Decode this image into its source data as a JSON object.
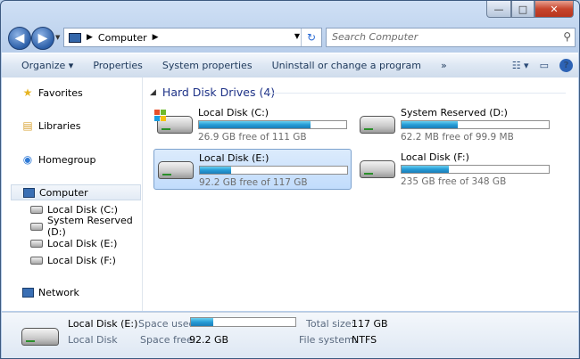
{
  "window": {
    "minimize": "—",
    "maximize": "□",
    "close": "✕"
  },
  "nav_buttons": {
    "back": "◀",
    "forward": "▶",
    "dropdown": "▼"
  },
  "address": {
    "path": [
      "Computer"
    ],
    "sep": "▶",
    "refresh": "↻"
  },
  "search": {
    "placeholder": "Search Computer",
    "icon": "⚲"
  },
  "toolbar": {
    "items": [
      "Organize ▾",
      "Properties",
      "System properties",
      "Uninstall or change a program",
      "»"
    ],
    "view_icon": "☷ ▾",
    "pane_icon": "▭",
    "help": "?"
  },
  "sidebar": {
    "favorites": "Favorites",
    "libraries": "Libraries",
    "homegroup": "Homegroup",
    "computer": "Computer",
    "drives": [
      "Local Disk (C:)",
      "System Reserved (D:)",
      "Local Disk (E:)",
      "Local Disk (F:)"
    ],
    "network": "Network"
  },
  "group": {
    "title": "Hard Disk Drives (4)"
  },
  "drives": [
    {
      "name": "Local Disk (C:)",
      "info": "26.9 GB free of 111 GB",
      "used_fraction": 0.76,
      "system": true,
      "selected": false
    },
    {
      "name": "System Reserved (D:)",
      "info": "62.2 MB free of 99.9 MB",
      "used_fraction": 0.38,
      "system": false,
      "selected": false
    },
    {
      "name": "Local Disk (E:)",
      "info": "92.2 GB free of 117 GB",
      "used_fraction": 0.21,
      "system": false,
      "selected": true
    },
    {
      "name": "Local Disk (F:)",
      "info": "235 GB free of 348 GB",
      "used_fraction": 0.32,
      "system": false,
      "selected": false
    }
  ],
  "details": {
    "name": "Local Disk (E:)",
    "type": "Local Disk",
    "space_used_label": "Space used:",
    "space_used_fraction": 0.21,
    "space_free_label": "Space free:",
    "space_free": "92.2 GB",
    "total_size_label": "Total size:",
    "total_size": "117 GB",
    "file_system_label": "File system:",
    "file_system": "NTFS"
  },
  "colors": {
    "bar_fill": "#269cd6",
    "selection": "#c1dcfc",
    "group_title": "#1e3287"
  }
}
